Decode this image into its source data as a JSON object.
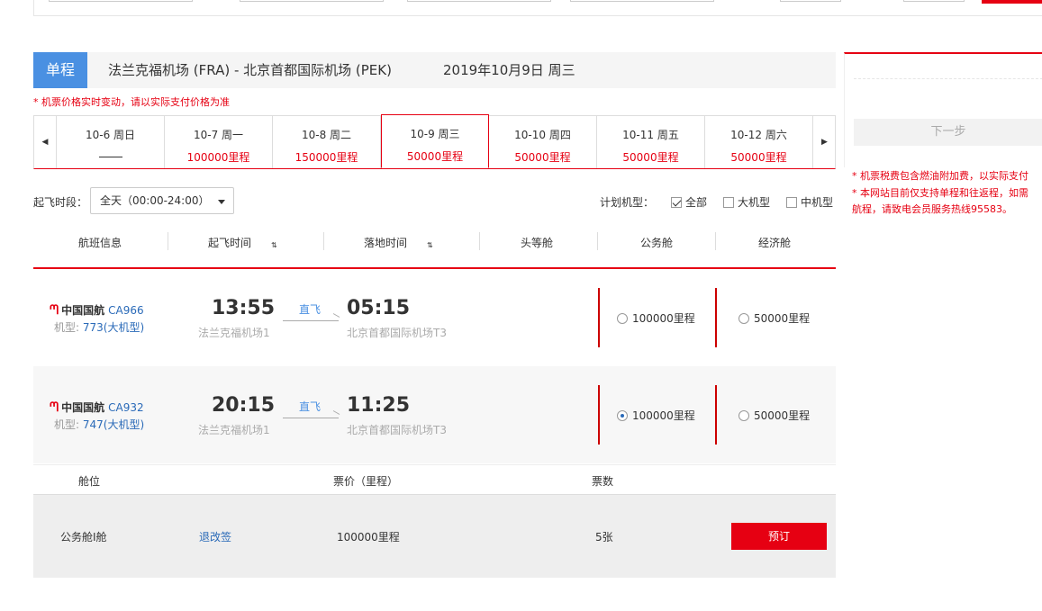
{
  "route": {
    "trip_type": "单程",
    "route_text": "法兰克福机场 (FRA) - 北京首都国际机场 (PEK)",
    "date_text": "2019年10月9日 周三"
  },
  "notice": "* 机票价格实时变动，请以实际支付价格为准",
  "date_strip": {
    "prev_icon": "◀",
    "next_icon": "▶",
    "dates": [
      {
        "label": "10-6 周日",
        "price": ""
      },
      {
        "label": "10-7 周一",
        "price": "100000里程"
      },
      {
        "label": "10-8 周二",
        "price": "150000里程"
      },
      {
        "label": "10-9 周三",
        "price": "50000里程",
        "active": true
      },
      {
        "label": "10-10 周四",
        "price": "50000里程"
      },
      {
        "label": "10-11 周五",
        "price": "50000里程"
      },
      {
        "label": "10-12 周六",
        "price": "50000里程"
      }
    ]
  },
  "filters": {
    "depart_label": "起飞时段：",
    "depart_value": "全天（00:00-24:00）",
    "plane_label": "计划机型：",
    "options": [
      {
        "label": "全部",
        "checked": true
      },
      {
        "label": "大机型",
        "checked": false
      },
      {
        "label": "中机型",
        "checked": false
      }
    ]
  },
  "table_header": {
    "flight_info": "航班信息",
    "depart_time": "起飞时间",
    "arrive_time": "落地时间",
    "first": "头等舱",
    "business": "公务舱",
    "economy": "经济舱",
    "sort_icon": "⇅"
  },
  "flights": [
    {
      "airline": "中国国航",
      "flight_no": "CA966",
      "model_label": "机型:",
      "model": "773(大机型)",
      "depart": "13:55",
      "depart_airport": "法兰克福机场1",
      "direct": "直飞",
      "arrive": "05:15",
      "arrive_airport": "北京首都国际机场T3",
      "business_price": "100000里程",
      "economy_price": "50000里程",
      "business_selected": false
    },
    {
      "airline": "中国国航",
      "flight_no": "CA932",
      "model_label": "机型:",
      "model": "747(大机型)",
      "depart": "20:15",
      "depart_airport": "法兰克福机场1",
      "direct": "直飞",
      "arrive": "11:25",
      "arrive_airport": "北京首都国际机场T3",
      "business_price": "100000里程",
      "economy_price": "50000里程",
      "business_selected": true
    }
  ],
  "cabin_detail": {
    "h_cabin": "舱位",
    "h_price": "票价（里程）",
    "h_count": "票数",
    "cabin": "公务舱I舱",
    "change_link": "退改签",
    "price": "100000里程",
    "count": "5张",
    "book_label": "预订"
  },
  "right_panel": {
    "next_label": "下一步",
    "note1": "* 机票税费包含燃油附加费，以实际支付",
    "note2": "* 本网站目前仅支持单程和往返程，如需",
    "note3": "航程，请致电会员服务热线95583。"
  },
  "colors": {
    "accent": "#e60012",
    "blue": "#4a90e2",
    "link": "#2a6ab8"
  }
}
